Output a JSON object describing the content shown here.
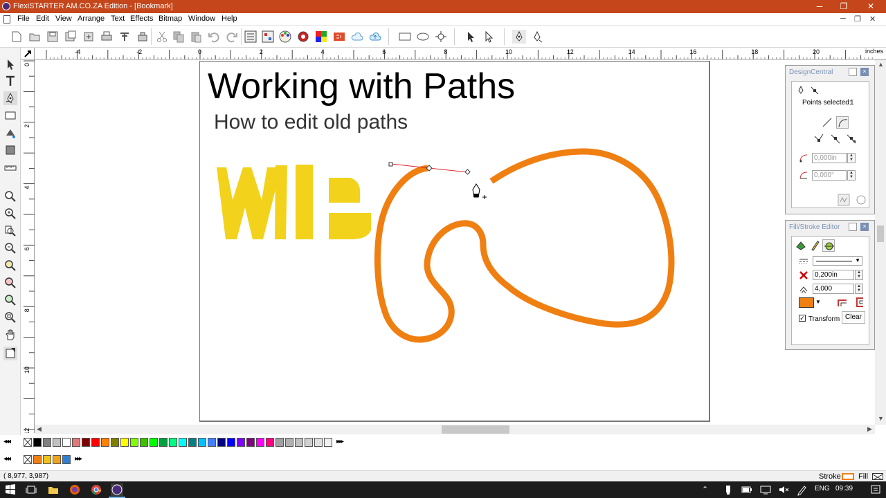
{
  "window": {
    "title": "FlexiSTARTER AM.CO.ZA Edition - [Bookmark]",
    "controls": [
      "─",
      "❐",
      "✕"
    ],
    "doc_controls": [
      "─",
      "❐",
      "✕"
    ]
  },
  "menu": [
    "File",
    "Edit",
    "View",
    "Arrange",
    "Text",
    "Effects",
    "Bitmap",
    "Window",
    "Help"
  ],
  "ruler": {
    "unit": "inches",
    "h_labels": [
      "-4",
      "-2",
      "0",
      "2",
      "4",
      "6",
      "8",
      "10",
      "12",
      "14",
      "16",
      "18",
      "20"
    ],
    "v_labels": [
      "0",
      "2",
      "4",
      "6",
      "8",
      "10",
      "12"
    ]
  },
  "document": {
    "title": "Working with Paths",
    "subtitle": "How to edit old paths",
    "logo_text": "WB",
    "logo_color": "#f2d21a",
    "path_color": "#f07f12",
    "handle_color": "#e0262b"
  },
  "design_central": {
    "title": "DesignCentral",
    "points_selected_label": "Points selected:",
    "points_selected_value": "1",
    "length_value": "0,000in",
    "angle_value": "0,000°"
  },
  "fill_stroke_editor": {
    "title": "Fill/Stroke Editor",
    "stroke_width": "0,200in",
    "miter_limit": "4,000",
    "stroke_color": "#f07f12",
    "transform_label": "Transform",
    "transform_checked": "✓",
    "clear_label": "Clear"
  },
  "palette": {
    "row1": [
      "#000000",
      "#808080",
      "#c0c0c0",
      "#ffffff",
      "#e07a7a",
      "#800000",
      "#ff0000",
      "#ff8000",
      "#808000",
      "#ffff00",
      "#80ff00",
      "#40c000",
      "#00ff00",
      "#00a040",
      "#00ff80",
      "#00ffff",
      "#008080",
      "#00c0ff",
      "#4080ff",
      "#000080",
      "#0000ff",
      "#8000ff",
      "#800080",
      "#ff00ff",
      "#ff0080",
      "#a0a0a0",
      "#b0b0b0",
      "#c0c0c0",
      "#d0d0d0",
      "#e0e0e0",
      "#f0f0f0"
    ],
    "row2": [
      "#f07f12",
      "#f2c21a",
      "#f2a21a",
      "#2f7fd6"
    ]
  },
  "status": {
    "coordinates": "(    8,977,     3,987)",
    "stroke_label": "Stroke",
    "stroke_color": "#f07f12",
    "fill_label": "Fill"
  },
  "taskbar": {
    "language": "ENG",
    "time": "09:39"
  }
}
